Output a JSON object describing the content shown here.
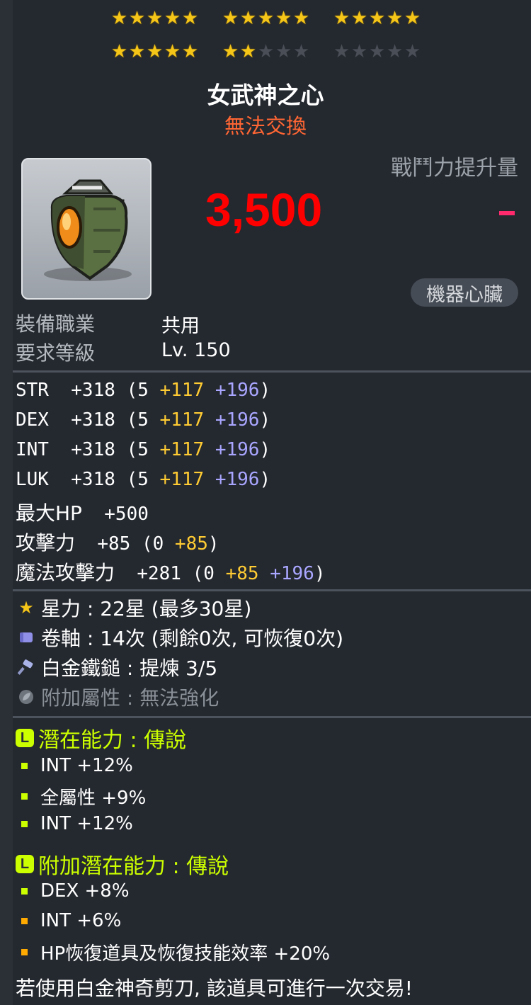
{
  "stars": {
    "rows": [
      {
        "groups": [
          5,
          5,
          5
        ],
        "filled": [
          5,
          5,
          5
        ]
      },
      {
        "groups": [
          5,
          5,
          5
        ],
        "filled": [
          5,
          2,
          0
        ]
      }
    ]
  },
  "item": {
    "name": "女武神之心",
    "trade_status": "無法交換",
    "cp_label": "戰鬥力提升量",
    "cp_value": "3,500",
    "cp_diff": "-",
    "category": "機器心臟"
  },
  "requirements": [
    {
      "label": "裝備職業",
      "value": "共用"
    },
    {
      "label": "要求等級",
      "value": "Lv. 150"
    }
  ],
  "stats": [
    {
      "name": "STR",
      "total": "+318",
      "base": "(5",
      "bonus": "+117",
      "enhance": "+196",
      "close": ")"
    },
    {
      "name": "DEX",
      "total": "+318",
      "base": "(5",
      "bonus": "+117",
      "enhance": "+196",
      "close": ")"
    },
    {
      "name": "INT",
      "total": "+318",
      "base": "(5",
      "bonus": "+117",
      "enhance": "+196",
      "close": ")"
    },
    {
      "name": "LUK",
      "total": "+318",
      "base": "(5",
      "bonus": "+117",
      "enhance": "+196",
      "close": ")"
    }
  ],
  "stats_extra": {
    "hp_name": "最大HP",
    "hp_value": "+500",
    "atk_name": "攻擊力",
    "atk_total": "+85",
    "atk_base": "(0",
    "atk_bonus": "+85",
    "atk_close": ")",
    "matk_name": "魔法攻擊力",
    "matk_total": "+281",
    "matk_base": "(0",
    "matk_bonus": "+85",
    "matk_enhance": "+196",
    "matk_close": ")"
  },
  "info": [
    {
      "icon": "star-icon",
      "text": "星力 : 22星 (最多30星)"
    },
    {
      "icon": "scroll-icon",
      "text": "卷軸 : 14次 (剩餘0次, 可恢復0次)"
    },
    {
      "icon": "hammer-icon",
      "text": "白金鐵鎚 : 提煉 3/5"
    },
    {
      "icon": "leaf-icon",
      "text": "附加屬性 : 無法強化"
    }
  ],
  "potential": {
    "badge": "L",
    "title": "潛在能力 : 傳說",
    "lines": [
      "INT +12%",
      "全屬性 +9%",
      "INT +12%"
    ]
  },
  "additional_potential": {
    "badge": "L",
    "title": "附加潛在能力 : 傳說",
    "lines": [
      "DEX +8%",
      "INT +6%",
      "HP恢復道具及恢復技能效率 +20%"
    ]
  },
  "colors": {
    "star_on": "#f5c518",
    "star_off": "#4a4f57",
    "cp_value": "#ff0000",
    "bonus_gold": "#ffcc33",
    "enhance_blue": "#a9a6ff",
    "legendary": "#ccff00",
    "untradeable": "#ff6633"
  },
  "footer": "若使用白金神奇剪刀, 該道具可進行一次交易!"
}
